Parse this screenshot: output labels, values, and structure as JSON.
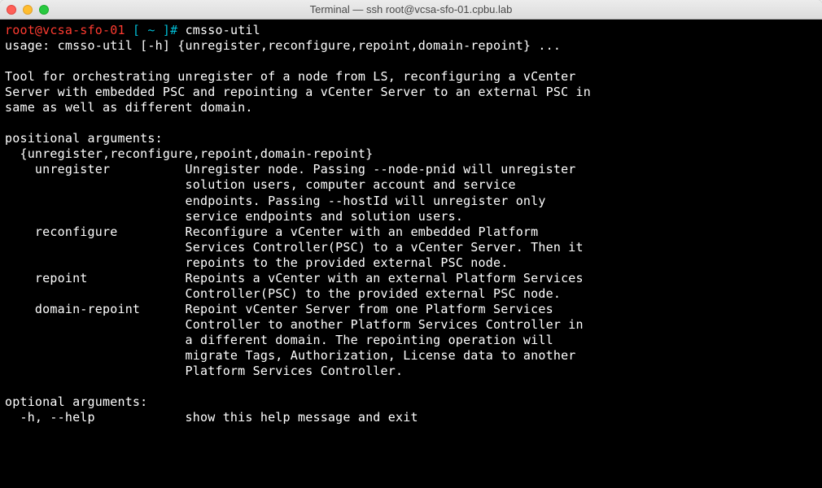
{
  "window": {
    "title": "Terminal — ssh root@vcsa-sfo-01.cpbu.lab"
  },
  "prompt": {
    "user_host": "root@vcsa-sfo-01",
    "lbracket": " [ ",
    "path": "~",
    "rbracket": " ]# ",
    "command": "cmsso-util"
  },
  "output": "usage: cmsso-util [-h] {unregister,reconfigure,repoint,domain-repoint} ...\n\nTool for orchestrating unregister of a node from LS, reconfiguring a vCenter\nServer with embedded PSC and repointing a vCenter Server to an external PSC in\nsame as well as different domain.\n\npositional arguments:\n  {unregister,reconfigure,repoint,domain-repoint}\n    unregister          Unregister node. Passing --node-pnid will unregister\n                        solution users, computer account and service\n                        endpoints. Passing --hostId will unregister only\n                        service endpoints and solution users.\n    reconfigure         Reconfigure a vCenter with an embedded Platform\n                        Services Controller(PSC) to a vCenter Server. Then it\n                        repoints to the provided external PSC node.\n    repoint             Repoints a vCenter with an external Platform Services\n                        Controller(PSC) to the provided external PSC node.\n    domain-repoint      Repoint vCenter Server from one Platform Services\n                        Controller to another Platform Services Controller in\n                        a different domain. The repointing operation will\n                        migrate Tags, Authorization, License data to another\n                        Platform Services Controller.\n\noptional arguments:\n  -h, --help            show this help message and exit"
}
